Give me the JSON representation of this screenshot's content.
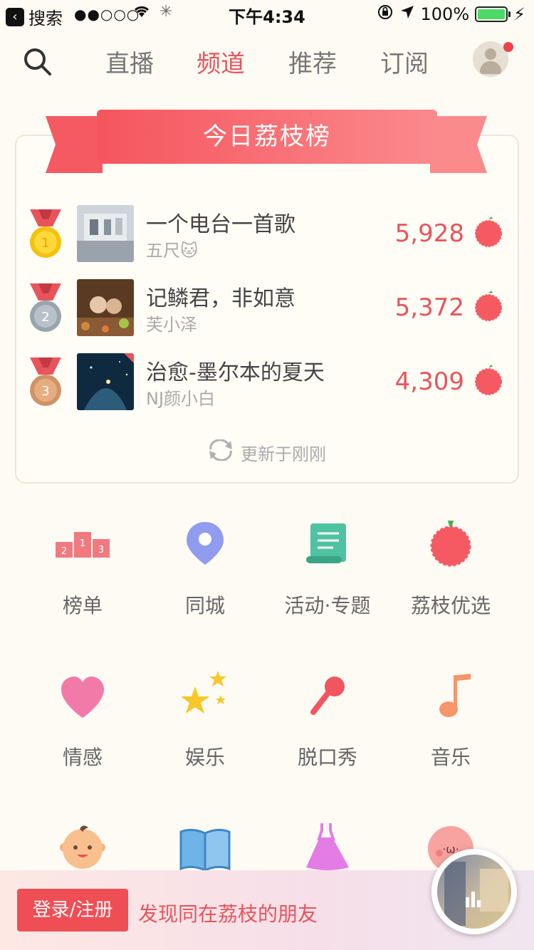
{
  "status_bar": {
    "back_app": "搜索",
    "signal": "●●○○○",
    "time": "下午4:34",
    "battery": "100%",
    "battery_level": 1.0
  },
  "nav": {
    "tabs": [
      {
        "label": "直播",
        "active": false
      },
      {
        "label": "频道",
        "active": true
      },
      {
        "label": "推荐",
        "active": false
      },
      {
        "label": "订阅",
        "active": false
      }
    ]
  },
  "ranking": {
    "title": "今日荔枝榜",
    "rows": [
      {
        "rank": "1",
        "title": "一个电台一首歌",
        "author": "五尺🐱",
        "score": "5,928"
      },
      {
        "rank": "2",
        "title": "记鳞君，非如意",
        "author": "芙小泽",
        "score": "5,372"
      },
      {
        "rank": "3",
        "title": "治愈-墨尔本的夏天",
        "author": "NJ颜小白",
        "score": "4,309"
      }
    ],
    "update_text": "更新于刚刚"
  },
  "categories": [
    {
      "label": "榜单",
      "icon": "podium-icon"
    },
    {
      "label": "同城",
      "icon": "location-pin-icon"
    },
    {
      "label": "活动·专题",
      "icon": "scroll-icon"
    },
    {
      "label": "荔枝优选",
      "icon": "lychee-icon"
    },
    {
      "label": "情感",
      "icon": "heart-icon"
    },
    {
      "label": "娱乐",
      "icon": "stars-icon"
    },
    {
      "label": "脱口秀",
      "icon": "microphone-icon"
    },
    {
      "label": "音乐",
      "icon": "music-note-icon"
    },
    {
      "label": "",
      "icon": "baby-face-icon"
    },
    {
      "label": "",
      "icon": "book-icon"
    },
    {
      "label": "",
      "icon": "dress-icon"
    },
    {
      "label": "",
      "icon": "blush-face-icon"
    }
  ],
  "bottom_bar": {
    "login_label": "登录/注册",
    "promo_text": "发现同在荔枝的朋友"
  },
  "colors": {
    "accent": "#e8545c",
    "background": "#fdfbf3"
  }
}
